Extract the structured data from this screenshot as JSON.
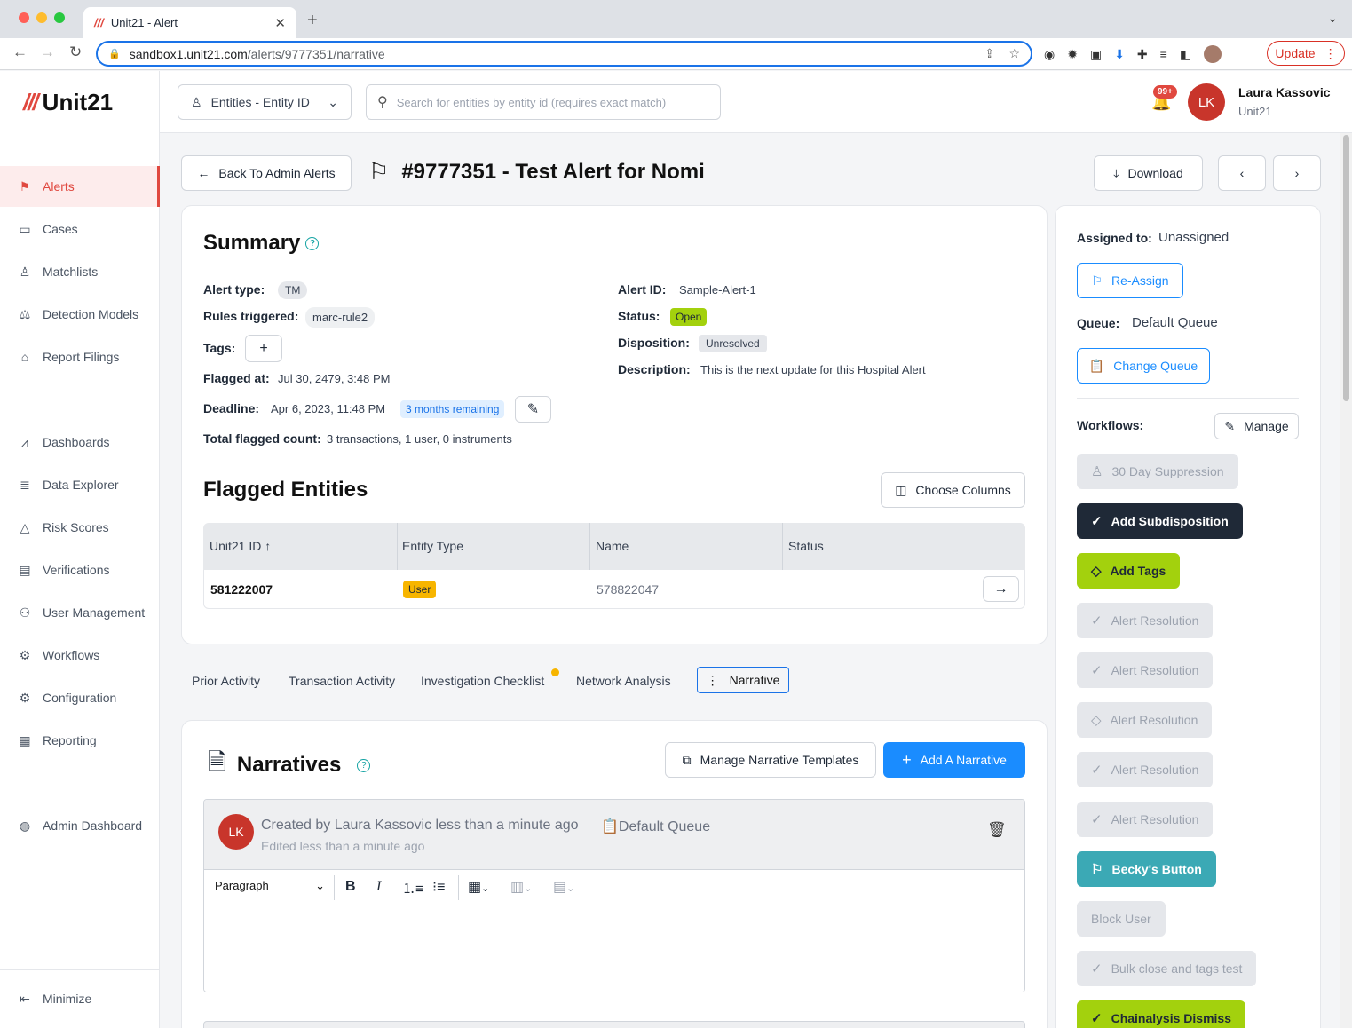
{
  "browser": {
    "tab_title": "Unit21 - Alert",
    "url_host": "sandbox1.unit21.com",
    "url_path": "/alerts/9777351/narrative",
    "update_label": "Update"
  },
  "brand": {
    "name": "Unit21",
    "mark": "///",
    "accent": "#e0483f"
  },
  "sidebar": {
    "items": [
      {
        "label": "Alerts",
        "icon": "flag-icon"
      },
      {
        "label": "Cases",
        "icon": "briefcase-icon"
      },
      {
        "label": "Matchlists",
        "icon": "user-x-icon"
      },
      {
        "label": "Detection Models",
        "icon": "scale-icon"
      },
      {
        "label": "Report Filings",
        "icon": "bank-icon"
      },
      {
        "label": "Dashboards",
        "icon": "chart-icon"
      },
      {
        "label": "Data Explorer",
        "icon": "search-list-icon"
      },
      {
        "label": "Risk Scores",
        "icon": "warning-icon"
      },
      {
        "label": "Verifications",
        "icon": "id-card-icon"
      },
      {
        "label": "User Management",
        "icon": "users-icon"
      },
      {
        "label": "Workflows",
        "icon": "workflow-gear-icon"
      },
      {
        "label": "Configuration",
        "icon": "gear-icon"
      },
      {
        "label": "Reporting",
        "icon": "report-icon"
      },
      {
        "label": "Admin Dashboard",
        "icon": "globe-icon"
      }
    ],
    "minimize_label": "Minimize"
  },
  "header": {
    "entity_selector": "Entities - Entity ID",
    "search_placeholder": "Search for entities by entity id (requires exact match)",
    "notifications": "99+",
    "user_initials": "LK",
    "user_name": "Laura Kassovic",
    "user_org": "Unit21"
  },
  "page": {
    "back_label": "Back To Admin Alerts",
    "title": "#9777351 - Test Alert for Nomi",
    "download_label": "Download"
  },
  "summary": {
    "heading": "Summary",
    "alert_type_label": "Alert type:",
    "alert_type": "TM",
    "rules_label": "Rules triggered:",
    "rule": "marc-rule2",
    "tags_label": "Tags:",
    "flagged_at_label": "Flagged at:",
    "flagged_at": "Jul 30, 2479, 3:48 PM",
    "deadline_label": "Deadline:",
    "deadline": "Apr 6, 2023, 11:48 PM",
    "deadline_badge": "3 months remaining",
    "total_label": "Total flagged count:",
    "total": "3 transactions, 1 user, 0 instruments",
    "alert_id_label": "Alert ID:",
    "alert_id": "Sample-Alert-1",
    "status_label": "Status:",
    "status": "Open",
    "disposition_label": "Disposition:",
    "disposition": "Unresolved",
    "description_label": "Description:",
    "description": "This is the next update for this Hospital Alert"
  },
  "flagged": {
    "heading": "Flagged Entities",
    "choose_columns": "Choose Columns",
    "columns": [
      "Unit21 ID",
      "Entity Type",
      "Name",
      "Status"
    ],
    "rows": [
      {
        "id": "581222007",
        "type": "User",
        "name": "578822047",
        "status": ""
      }
    ]
  },
  "tabs": [
    "Prior Activity",
    "Transaction Activity",
    "Investigation Checklist",
    "Network Analysis",
    "Narrative"
  ],
  "narratives": {
    "heading": "Narratives",
    "manage_templates": "Manage Narrative Templates",
    "add": "Add A Narrative",
    "entry": {
      "initials": "LK",
      "created": "Created by Laura Kassovic less than a minute ago",
      "queue": "Default Queue",
      "edited": "Edited less than a minute ago"
    },
    "editor_style": "Paragraph"
  },
  "right_panel": {
    "assigned_label": "Assigned to:",
    "assigned": "Unassigned",
    "reassign": "Re-Assign",
    "queue_label": "Queue:",
    "queue": "Default Queue",
    "change_queue": "Change Queue",
    "workflows_label": "Workflows:",
    "manage": "Manage",
    "workflows": [
      {
        "label": "30 Day Suppression",
        "style": "dis",
        "icon": "user-check-icon"
      },
      {
        "label": "Add Subdisposition",
        "style": "dark",
        "icon": "check-circle-icon"
      },
      {
        "label": "Add Tags",
        "style": "green",
        "icon": "tag-icon"
      },
      {
        "label": "Alert Resolution",
        "style": "dis",
        "icon": "check-circle-icon"
      },
      {
        "label": "Alert Resolution",
        "style": "dis",
        "icon": "check-circle-icon"
      },
      {
        "label": "Alert Resolution",
        "style": "dis",
        "icon": "tag-icon"
      },
      {
        "label": "Alert Resolution",
        "style": "dis",
        "icon": "check-circle-icon"
      },
      {
        "label": "Alert Resolution",
        "style": "dis",
        "icon": "check-circle-icon"
      },
      {
        "label": "Becky's Button",
        "style": "teal",
        "icon": "flag-arrow-icon"
      },
      {
        "label": "Block User",
        "style": "dis",
        "icon": ""
      },
      {
        "label": "Bulk close and tags test",
        "style": "dis",
        "icon": "check-circle-icon"
      },
      {
        "label": "Chainalysis Dismiss",
        "style": "green",
        "icon": "check-circle-icon"
      }
    ]
  }
}
